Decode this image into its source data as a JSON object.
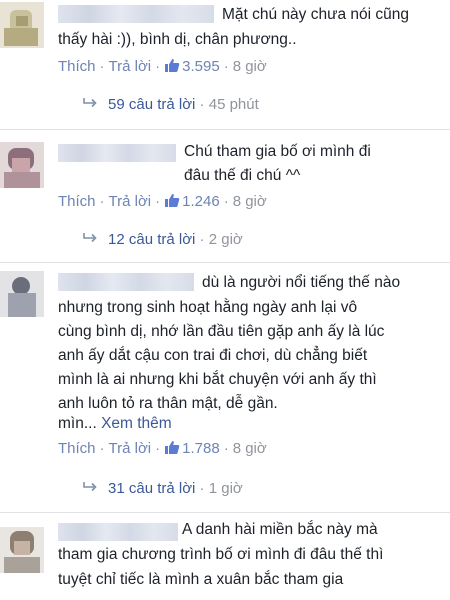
{
  "comments": [
    {
      "text_lines": [
        "Mặt chú này chưa nói cũng",
        "thấy hài :)), bình dị, chân phương.."
      ],
      "like": "Thích",
      "reply": "Trả lời",
      "likes": "3.595",
      "time": "8 giờ",
      "replies_label": "59 câu trả lời",
      "replies_time": "45 phút"
    },
    {
      "text_lines": [
        "Chú tham gia bố ơi mình đi",
        "đâu thế đi chú ^^"
      ],
      "like": "Thích",
      "reply": "Trả lời",
      "likes": "1.246",
      "time": "8 giờ",
      "replies_label": "12 câu trả lời",
      "replies_time": "2 giờ"
    },
    {
      "text_lines": [
        "dù là người nổi tiếng thế nào",
        "nhưng trong sinh hoạt hằng ngày anh lại vô",
        "cùng bình dị, nhớ lần đầu tiên gặp anh ấy là lúc",
        "anh ấy dắt cậu con trai đi chơi, dù chẳng biết",
        "mình là ai nhưng khi bắt chuyện với anh ấy thì",
        "anh luôn tỏ ra thân mật, dễ gần."
      ],
      "truncated": "mìn...",
      "see_more": "Xem thêm",
      "like": "Thích",
      "reply": "Trả lời",
      "likes": "1.788",
      "time": "8 giờ",
      "replies_label": "31 câu trả lời",
      "replies_time": "1 giờ"
    },
    {
      "text_lines": [
        "A danh hài miền bắc này mà",
        "tham gia chương trình bố ơi mình đi đâu thế thì",
        "tuyệt chỉ tiếc là mình a xuân bắc tham gia"
      ]
    }
  ],
  "colors": {
    "link": "#3b5998",
    "action": "#6d84b4",
    "meta": "#90949c"
  }
}
